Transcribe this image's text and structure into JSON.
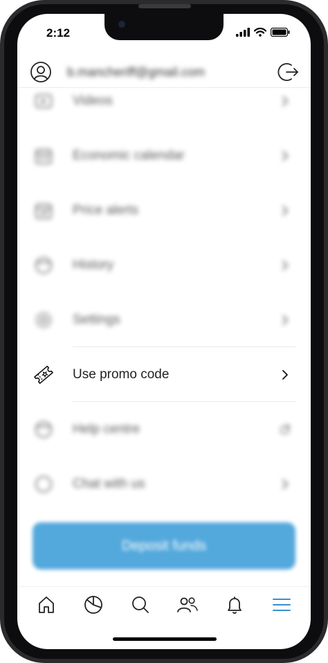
{
  "status_bar": {
    "time": "2:12"
  },
  "header": {
    "email": "b.mancheriff@gmail.com"
  },
  "menu": {
    "items": [
      {
        "label": "Videos",
        "icon": "video-icon",
        "blurred": true
      },
      {
        "label": "Economic calendar",
        "icon": "calendar-icon",
        "blurred": true
      },
      {
        "label": "Price alerts",
        "icon": "price-alert-icon",
        "blurred": true
      },
      {
        "label": "History",
        "icon": "history-icon",
        "blurred": true
      },
      {
        "label": "Settings",
        "icon": "settings-icon",
        "blurred": true
      },
      {
        "label": "Use promo code",
        "icon": "ticket-icon",
        "blurred": false
      },
      {
        "label": "Help centre",
        "icon": "help-icon",
        "blurred": true
      },
      {
        "label": "Chat with us",
        "icon": "chat-icon",
        "blurred": true
      }
    ]
  },
  "deposit": {
    "label": "Deposit funds"
  },
  "tabbar": {
    "tabs": [
      {
        "name": "home",
        "icon": "home-icon"
      },
      {
        "name": "portfolio",
        "icon": "pie-chart-icon"
      },
      {
        "name": "search",
        "icon": "search-icon"
      },
      {
        "name": "community",
        "icon": "people-icon"
      },
      {
        "name": "notifications",
        "icon": "bell-icon"
      },
      {
        "name": "menu",
        "icon": "hamburger-icon",
        "active": true
      }
    ]
  },
  "colors": {
    "accent": "#3a8fd0",
    "deposit_bg": "#53a8dc",
    "frame": "#2b2b2e"
  }
}
